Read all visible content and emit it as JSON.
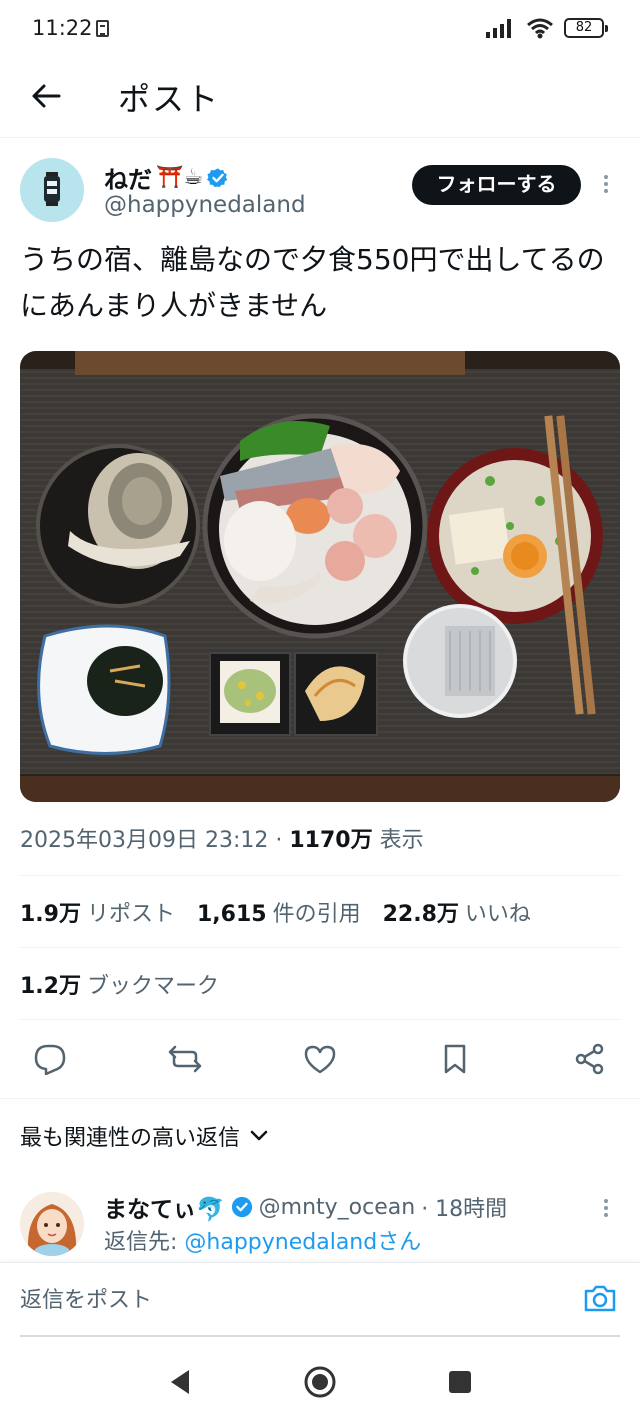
{
  "status_bar": {
    "time": "11:22",
    "battery": "82"
  },
  "header": {
    "title": "ポスト"
  },
  "post": {
    "display_name": "ねだ",
    "name_emojis": "⛩️☕",
    "handle": "@happynedaland",
    "follow_label": "フォローする",
    "text": "うちの宿、離島なので夕食550円で出してるのにあんまり人がきません",
    "timestamp": "2025年03月09日 23:12",
    "views_count": "1170万",
    "views_label": "表示",
    "stats": {
      "reposts_count": "1.9万",
      "reposts_label": "リポスト",
      "quotes_count": "1,615",
      "quotes_label": "件の引用",
      "likes_count": "22.8万",
      "likes_label": "いいね",
      "bookmarks_count": "1.2万",
      "bookmarks_label": "ブックマーク"
    }
  },
  "replies": {
    "sort_label": "最も関連性の高い返信",
    "first": {
      "display_name": "まなてぃ🐬",
      "handle": "@mnty_ocean",
      "time": "· 18時間",
      "reply_to_prefix": "返信先: ",
      "reply_to_handle": "@happynedalandさん"
    }
  },
  "compose": {
    "placeholder": "返信をポスト"
  },
  "colors": {
    "accent": "#1d9bf0",
    "text": "#0f1419",
    "muted": "#536471"
  }
}
